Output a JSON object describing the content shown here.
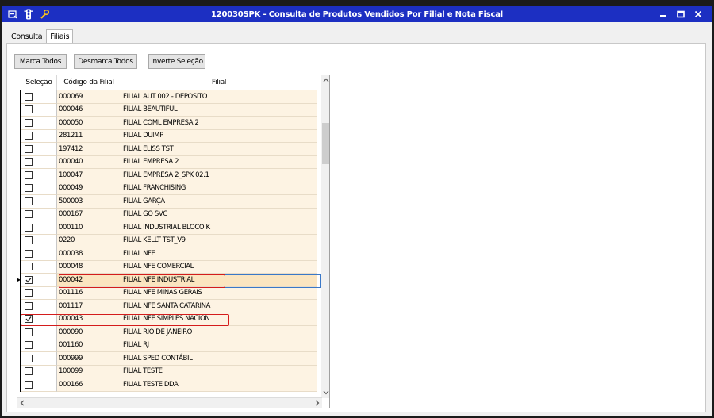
{
  "window": {
    "title": "120030SPK - Consulta de Produtos Vendidos Por Filial e Nota Fiscal",
    "colors": {
      "titlebar": "#1c2fc2",
      "row_bg": "#fdf3e3",
      "highlight": "#d41c1c"
    }
  },
  "tabs": [
    {
      "label": "Consulta",
      "active": false
    },
    {
      "label": "Filiais",
      "active": true
    }
  ],
  "toolbar": {
    "mark_all": "Marca Todos",
    "unmark_all": "Desmarca Todos",
    "invert": "Inverte Seleção"
  },
  "grid": {
    "columns": [
      "Seleção",
      "Código da Filial",
      "Filial"
    ],
    "rows": [
      {
        "checked": false,
        "code": "000069",
        "name": "FILIAL AUT 002 - DEPOSITO"
      },
      {
        "checked": false,
        "code": "000046",
        "name": "FILIAL BEAUTIFUL"
      },
      {
        "checked": false,
        "code": "000050",
        "name": "FILIAL COML EMPRESA 2"
      },
      {
        "checked": false,
        "code": "281211",
        "name": "FILIAL DUIMP"
      },
      {
        "checked": false,
        "code": "197412",
        "name": "FILIAL ELISS TST"
      },
      {
        "checked": false,
        "code": "000040",
        "name": "FILIAL EMPRESA 2"
      },
      {
        "checked": false,
        "code": "100047",
        "name": "FILIAL EMPRESA 2_SPK 02.1"
      },
      {
        "checked": false,
        "code": "000049",
        "name": "FILIAL FRANCHISING"
      },
      {
        "checked": false,
        "code": "500003",
        "name": "FILIAL GARÇA"
      },
      {
        "checked": false,
        "code": "000167",
        "name": "FILIAL GO SVC"
      },
      {
        "checked": false,
        "code": "000110",
        "name": "FILIAL INDUSTRIAL BLOCO K"
      },
      {
        "checked": false,
        "code": "0220",
        "name": "FILIAL KELLT TST_V9"
      },
      {
        "checked": false,
        "code": "000038",
        "name": "FILIAL NFE"
      },
      {
        "checked": false,
        "code": "000048",
        "name": "FILIAL NFE COMERCIAL"
      },
      {
        "checked": true,
        "code": "000042",
        "name": "FILIAL NFE INDUSTRIAL",
        "current": true
      },
      {
        "checked": false,
        "code": "001116",
        "name": "FILIAL NFE MINAS GERAIS"
      },
      {
        "checked": false,
        "code": "001117",
        "name": "FILIAL NFE SANTA CATARINA"
      },
      {
        "checked": true,
        "code": "000043",
        "name": "FILIAL NFE SIMPLES NACION"
      },
      {
        "checked": false,
        "code": "000090",
        "name": "FILIAL RIO DE JANEIRO"
      },
      {
        "checked": false,
        "code": "001160",
        "name": "FILIAL RJ"
      },
      {
        "checked": false,
        "code": "000999",
        "name": "FILIAL SPED CONTÁBIL"
      },
      {
        "checked": false,
        "code": "100099",
        "name": "FILIAL TESTE"
      },
      {
        "checked": false,
        "code": "000166",
        "name": "FILIAL TESTE DDA"
      }
    ]
  },
  "icons": {
    "window_menu": "window-menu-icon",
    "traffic": "traffic-light-icon",
    "tool": "wrench-icon",
    "minimize": "minimize-icon",
    "maximize": "maximize-icon",
    "close": "close-icon"
  }
}
